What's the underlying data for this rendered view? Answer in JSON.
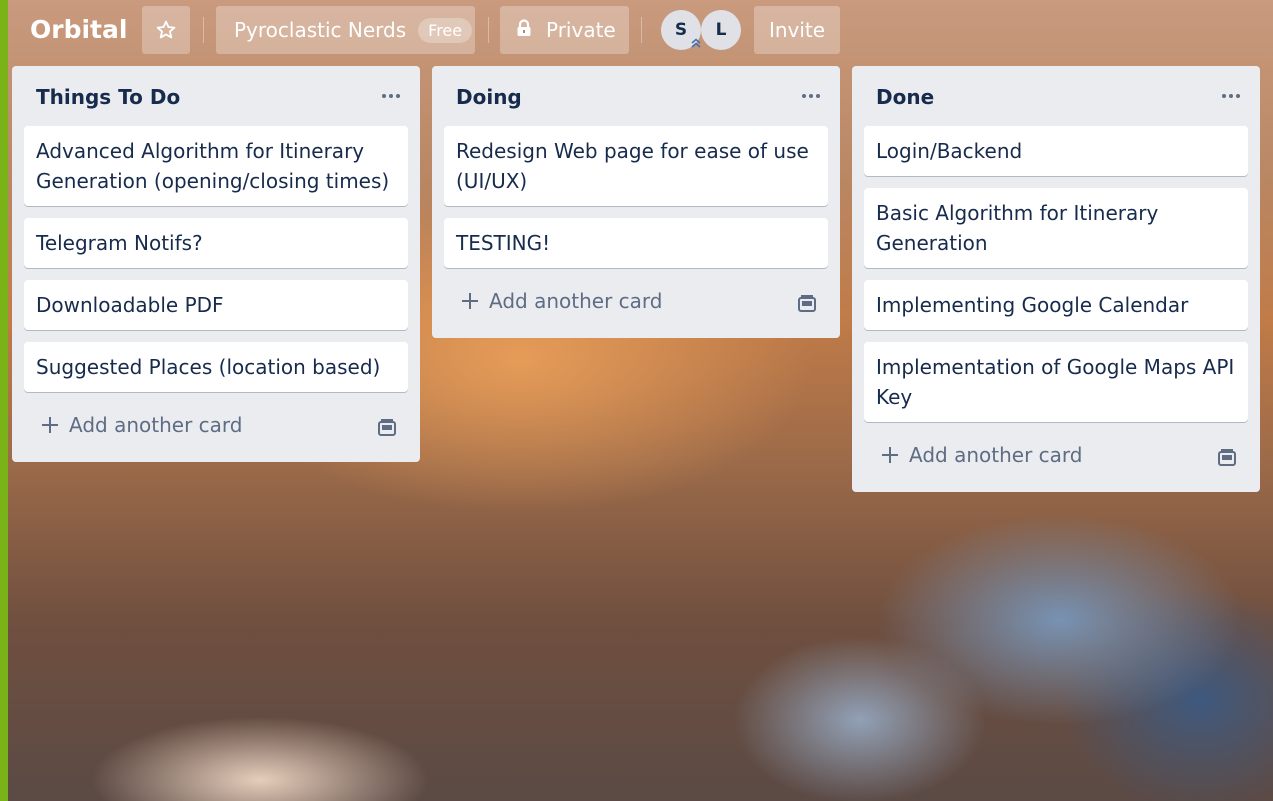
{
  "board": {
    "title": "Orbital",
    "team_name": "Pyroclastic Nerds",
    "team_plan": "Free",
    "visibility": "Private",
    "invite_label": "Invite",
    "members": [
      "S",
      "L"
    ]
  },
  "lists": [
    {
      "title": "Things To Do",
      "cards": [
        "Advanced Algorithm for Itinerary Generation (opening/closing times)",
        "Telegram Notifs?",
        "Downloadable PDF",
        "Suggested Places (location based)"
      ],
      "add_label": "Add another card"
    },
    {
      "title": "Doing",
      "cards": [
        "Redesign Web page for ease of use (UI/UX)",
        "TESTING!"
      ],
      "add_label": "Add another card"
    },
    {
      "title": "Done",
      "cards": [
        "Login/Backend",
        "Basic Algorithm for Itinerary Generation",
        "Implementing Google Calendar",
        "Implementation of Google Maps API Key"
      ],
      "add_label": "Add another card"
    }
  ],
  "icons": {
    "star": "star-icon",
    "lock": "lock-icon",
    "menu": "more-horizontal-icon",
    "add": "plus-icon",
    "template": "card-template-icon",
    "admin": "admin-chevron-icon"
  },
  "colors": {
    "accent": "#7ab317",
    "list_bg": "#ebecf0",
    "text": "#172b4d",
    "muted": "#5e6c84"
  }
}
